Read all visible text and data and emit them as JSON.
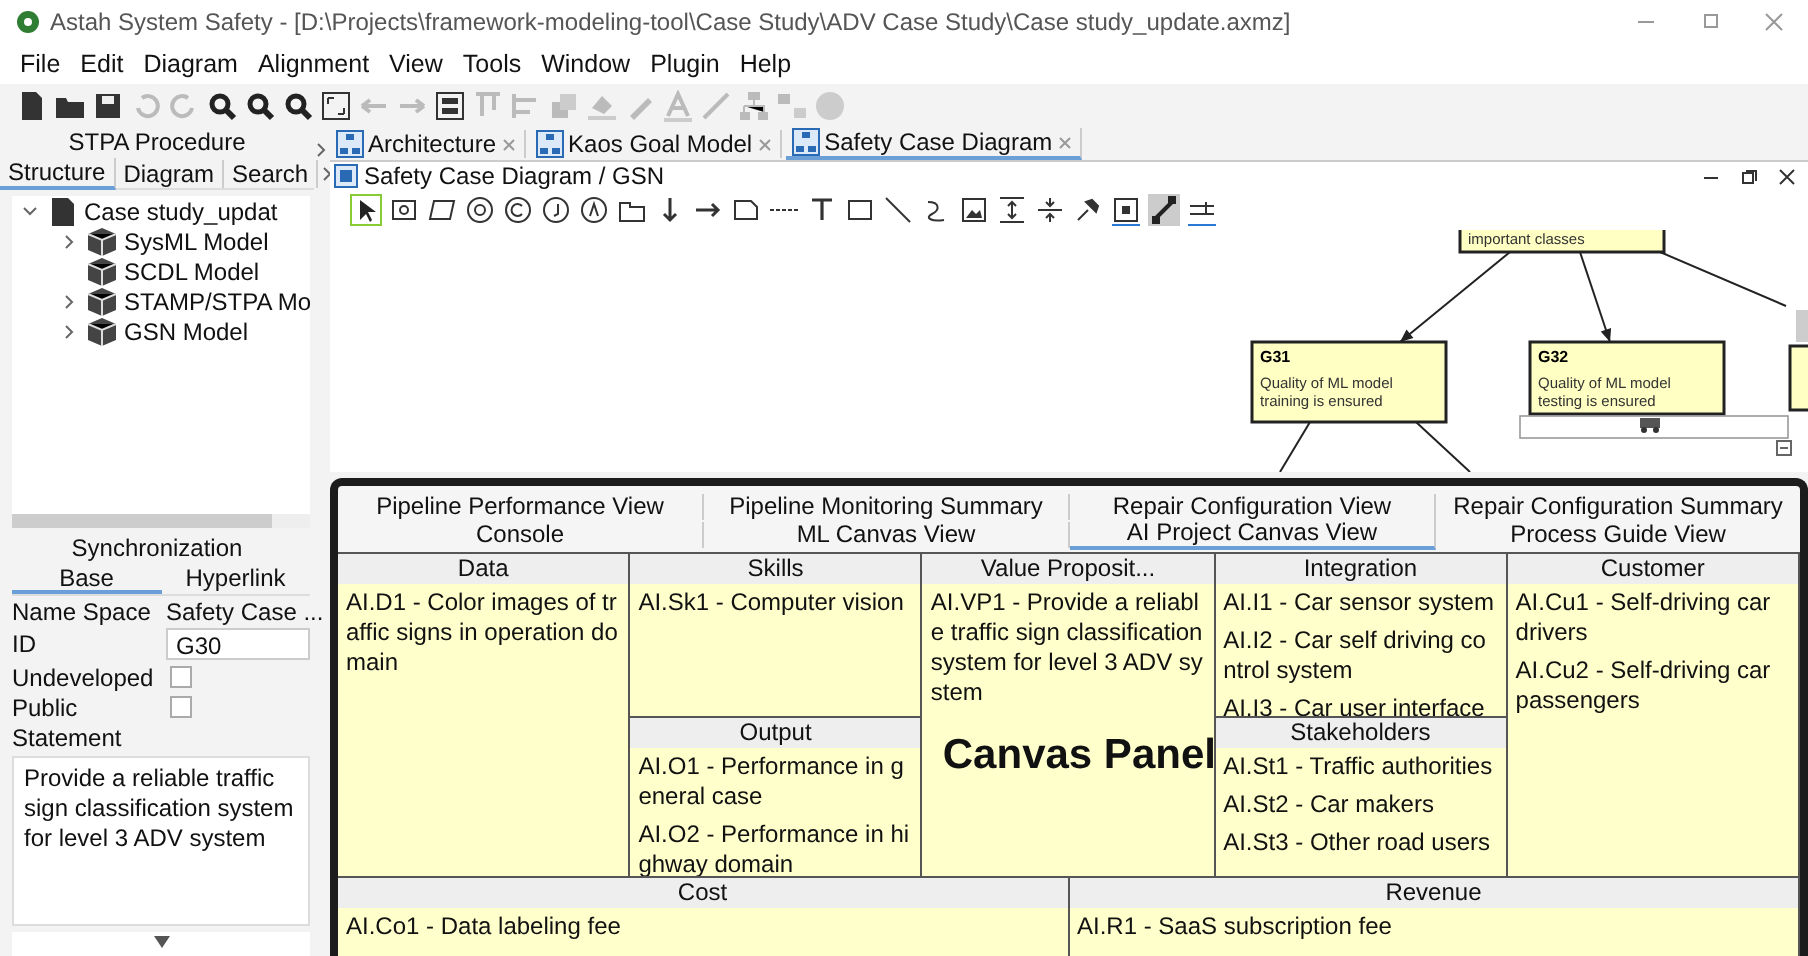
{
  "window": {
    "title": "Astah System Safety - [D:\\Projects\\framework-modeling-tool\\Case Study\\ADV Case Study\\Case study_update.axmz]"
  },
  "menu": [
    "File",
    "Edit",
    "Diagram",
    "Alignment",
    "View",
    "Tools",
    "Window",
    "Plugin",
    "Help"
  ],
  "left_panel": {
    "title": "STPA Procedure",
    "tabs": [
      {
        "label": "Structure",
        "selected": true
      },
      {
        "label": "Diagram",
        "selected": false
      },
      {
        "label": "Search",
        "selected": false
      }
    ],
    "tree": [
      {
        "label": "Case study_updat",
        "expanded": true,
        "children": [
          {
            "label": "SysML Model",
            "expandable": true
          },
          {
            "label": "SCDL Model",
            "expandable": false
          },
          {
            "label": "STAMP/STPA Mo",
            "expandable": true
          },
          {
            "label": "GSN Model",
            "expandable": true
          }
        ]
      }
    ]
  },
  "properties": {
    "title": "Synchronization",
    "tabs": [
      {
        "label": "Base",
        "selected": true
      },
      {
        "label": "Hyperlink",
        "selected": false
      }
    ],
    "fields": [
      {
        "kind": "text",
        "label": "Name Space",
        "value": "Safety Case ..."
      },
      {
        "kind": "input",
        "label": "ID",
        "value": "G30"
      },
      {
        "kind": "checkbox",
        "label": "Undeveloped",
        "checked": false
      },
      {
        "kind": "checkbox",
        "label": "Public",
        "checked": false
      },
      {
        "kind": "heading",
        "label": "Statement"
      }
    ],
    "statement": "Provide a reliable traffic sign classification system for level 3 ADV system"
  },
  "editor_tabs": [
    {
      "label": "Architecture",
      "selected": false
    },
    {
      "label": "Kaos Goal Model",
      "selected": false
    },
    {
      "label": "Safety Case Diagram",
      "selected": true
    }
  ],
  "diagram": {
    "title": "Safety Case Diagram / GSN",
    "nodes": [
      {
        "text": "important classes"
      },
      {
        "label": "G31",
        "text": "Quality of ML model training is ensured"
      },
      {
        "label": "G32",
        "text": "Quality of ML model testing is ensured"
      }
    ]
  },
  "canvas_panel": {
    "tab_rows": [
      [
        {
          "label": "Pipeline Performance View",
          "selected": false
        },
        {
          "label": "Pipeline Monitoring Summary",
          "selected": false
        },
        {
          "label": "Repair Configuration View",
          "selected": false
        },
        {
          "label": "Repair Configuration Summary",
          "selected": false
        }
      ],
      [
        {
          "label": "Console",
          "selected": false
        },
        {
          "label": "ML Canvas View",
          "selected": false
        },
        {
          "label": "AI Project Canvas View",
          "selected": true
        },
        {
          "label": "Process Guide View",
          "selected": false
        }
      ]
    ],
    "overlay_label": "Canvas Panel",
    "upper_blocks": [
      {
        "title": "Data",
        "items": [
          "AI.D1 - Color images of traffic signs in operation domain"
        ]
      },
      {
        "title": "Skills",
        "items": [
          "AI.Sk1 - Computer vision"
        ]
      },
      {
        "title": "Value Proposit...",
        "items": [
          "AI.VP1 - Provide a reliable traffic sign classification system for level 3 ADV system"
        ]
      },
      {
        "title": "Integration",
        "items": [
          "AI.I1 - Car sensor system",
          "AI.I2 - Car self driving control system",
          "AI.I3 - Car user interface"
        ]
      },
      {
        "title": "Customer",
        "items": [
          "AI.Cu1 - Self-driving car drivers",
          "AI.Cu2 - Self-driving car passengers"
        ]
      },
      {
        "title": "Output",
        "items": [
          "AI.O1 - Performance in general case",
          "AI.O2 - Performance in highway domain"
        ]
      },
      {
        "title": "Stakeholders",
        "items": [
          "AI.St1 - Traffic authorities",
          "AI.St2 - Car makers",
          "AI.St3 - Other road users"
        ]
      }
    ],
    "lower_blocks": [
      {
        "title": "Cost",
        "items": [
          "AI.Co1 - Data labeling fee"
        ]
      },
      {
        "title": "Revenue",
        "items": [
          "AI.R1 - SaaS subscription fee"
        ]
      }
    ]
  }
}
